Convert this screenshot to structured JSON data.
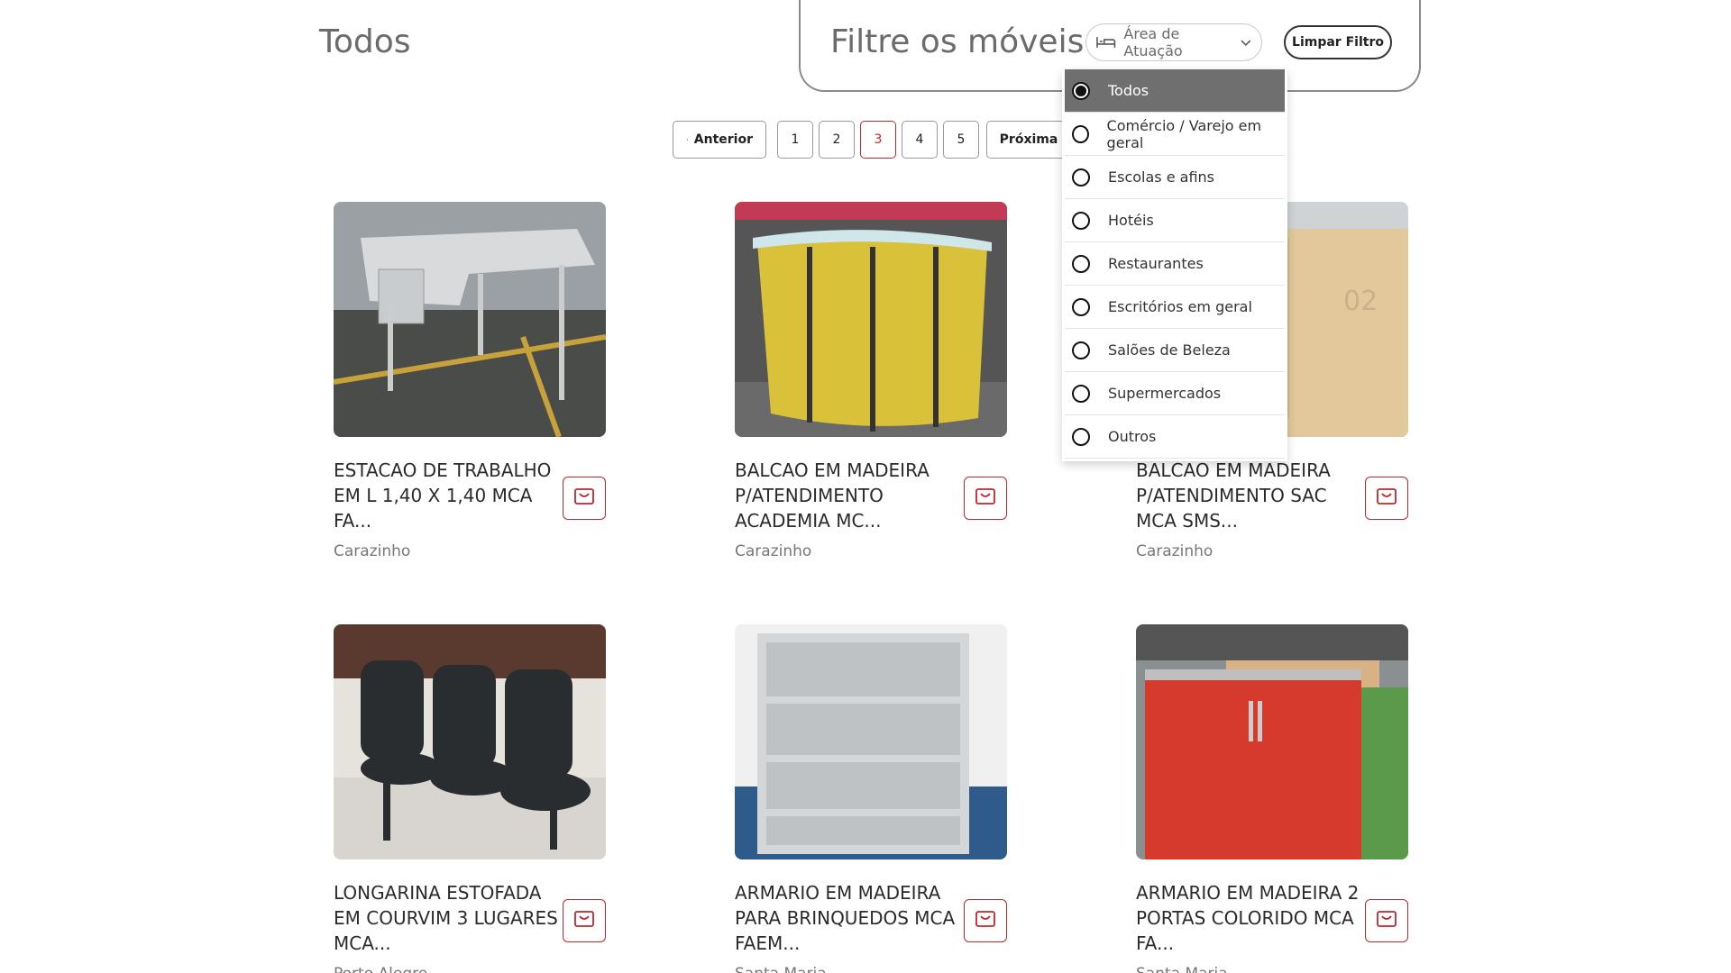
{
  "page": {
    "title": "Todos"
  },
  "filter": {
    "title": "Filtre os móveis",
    "area_select_label": "Área de Atuação",
    "clear_label": "Limpar Filtro",
    "options": [
      {
        "label": "Todos",
        "selected": true
      },
      {
        "label": "Comércio / Varejo em geral",
        "selected": false
      },
      {
        "label": "Escolas e afins",
        "selected": false
      },
      {
        "label": "Hotéis",
        "selected": false
      },
      {
        "label": "Restaurantes",
        "selected": false
      },
      {
        "label": "Escritórios em geral",
        "selected": false
      },
      {
        "label": "Salões de Beleza",
        "selected": false
      },
      {
        "label": "Supermercados",
        "selected": false
      },
      {
        "label": "Outros",
        "selected": false
      }
    ]
  },
  "pagination": {
    "prev_label": "Anterior",
    "next_label": "Próxima",
    "pages": [
      "1",
      "2",
      "3",
      "4",
      "5"
    ],
    "current": "3"
  },
  "products": [
    {
      "title": "ESTACAO DE TRABALHO EM L 1,40 X 1,40 MCA FA...",
      "city": "Carazinho",
      "image": "l-shaped-desk"
    },
    {
      "title": "BALCAO EM MADEIRA P/ATENDIMENTO ACADEMIA MC...",
      "city": "Carazinho",
      "image": "yellow-reception-counter"
    },
    {
      "title": "BALCAO EM MADEIRA P/ATENDIMENTO SAC MCA SMS...",
      "city": "Carazinho",
      "image": "wood-counter-02"
    },
    {
      "title": "LONGARINA ESTOFADA EM COURVIM 3 LUGARES MCA...",
      "city": "Porto Alegre",
      "image": "three-seat-chairs"
    },
    {
      "title": "ARMARIO EM MADEIRA PARA BRINQUEDOS MCA FAEM...",
      "city": "Santa Maria",
      "image": "gray-bookshelf"
    },
    {
      "title": "ARMARIO EM MADEIRA 2 PORTAS COLORIDO MCA FA...",
      "city": "Santa Maria",
      "image": "red-cabinet"
    }
  ],
  "colors": {
    "accent": "#c0262b",
    "selected_option_bg": "#6f6f6f"
  }
}
